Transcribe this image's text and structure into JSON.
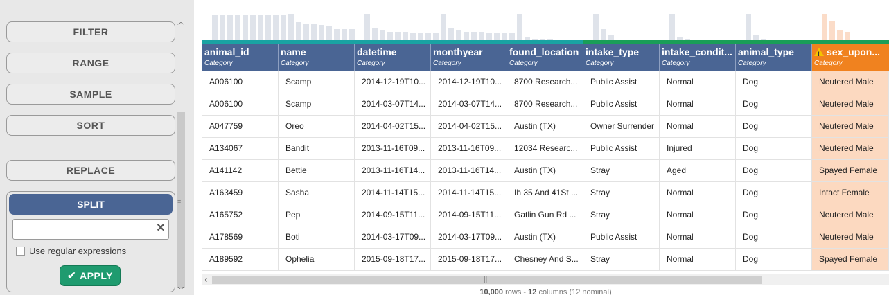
{
  "panel": {
    "buttons": [
      "FILTER",
      "RANGE",
      "SAMPLE",
      "SORT",
      "REPLACE"
    ],
    "split": {
      "title": "SPLIT",
      "input_value": "",
      "regex_label": "Use regular expressions",
      "apply_label": "APPLY"
    }
  },
  "columns": [
    {
      "name": "animal_id",
      "type": "Category",
      "strip": "#1aa3a3",
      "bars": [
        0.9,
        0.9,
        0.9,
        0.9,
        0.9,
        0.9,
        0.9,
        0.9,
        0.9,
        0.9
      ]
    },
    {
      "name": "name",
      "type": "Category",
      "strip": "#1aa3a3",
      "bars": [
        0.95,
        0.65,
        0.6,
        0.6,
        0.55,
        0.5,
        0.4,
        0.4,
        0.4
      ]
    },
    {
      "name": "datetime",
      "type": "Category",
      "strip": "#1aa3a3",
      "bars": [
        0.95,
        0.45,
        0.35,
        0.3,
        0.3,
        0.3,
        0.25,
        0.25,
        0.25,
        0.25
      ]
    },
    {
      "name": "monthyear",
      "type": "Category",
      "strip": "#1aa3a3",
      "bars": [
        0.95,
        0.45,
        0.35,
        0.3,
        0.3,
        0.3,
        0.25,
        0.25,
        0.25,
        0.25
      ]
    },
    {
      "name": "found_location",
      "type": "Category",
      "strip": "#1aa3a3",
      "bars": [
        0.95,
        0.1,
        0.05,
        0.05,
        0.05
      ]
    },
    {
      "name": "intake_type",
      "type": "Category",
      "strip": "#1a9e58",
      "bars": [
        0.95,
        0.4,
        0.2
      ]
    },
    {
      "name": "intake_condit...",
      "type": "Category",
      "strip": "#1a9e58",
      "bars": [
        0.95,
        0.1,
        0.05
      ]
    },
    {
      "name": "animal_type",
      "type": "Category",
      "strip": "#1a9e58",
      "bars": [
        0.95,
        0.2,
        0.05
      ]
    },
    {
      "name": "sex_upon...",
      "type": "Category",
      "strip": "#1a9e58",
      "bars": [
        0.95,
        0.7,
        0.35,
        0.3
      ],
      "warn": true
    }
  ],
  "rows": [
    [
      "A006100",
      "Scamp",
      "2014-12-19T10...",
      "2014-12-19T10...",
      "8700 Research...",
      "Public Assist",
      "Normal",
      "Dog",
      "Neutered Male"
    ],
    [
      "A006100",
      "Scamp",
      "2014-03-07T14...",
      "2014-03-07T14...",
      "8700 Research...",
      "Public Assist",
      "Normal",
      "Dog",
      "Neutered Male"
    ],
    [
      "A047759",
      "Oreo",
      "2014-04-02T15...",
      "2014-04-02T15...",
      "Austin (TX)",
      "Owner Surrender",
      "Normal",
      "Dog",
      "Neutered Male"
    ],
    [
      "A134067",
      "Bandit",
      "2013-11-16T09...",
      "2013-11-16T09...",
      "12034 Researc...",
      "Public Assist",
      "Injured",
      "Dog",
      "Neutered Male"
    ],
    [
      "A141142",
      "Bettie",
      "2013-11-16T14...",
      "2013-11-16T14...",
      "Austin (TX)",
      "Stray",
      "Aged",
      "Dog",
      "Spayed Female"
    ],
    [
      "A163459",
      "Sasha",
      "2014-11-14T15...",
      "2014-11-14T15...",
      "Ih 35 And 41St ...",
      "Stray",
      "Normal",
      "Dog",
      "Intact Female"
    ],
    [
      "A165752",
      "Pep",
      "2014-09-15T11...",
      "2014-09-15T11...",
      "Gatlin Gun Rd ...",
      "Stray",
      "Normal",
      "Dog",
      "Neutered Male"
    ],
    [
      "A178569",
      "Boti",
      "2014-03-17T09...",
      "2014-03-17T09...",
      "Austin (TX)",
      "Public Assist",
      "Normal",
      "Dog",
      "Neutered Male"
    ],
    [
      "A189592",
      "Ophelia",
      "2015-09-18T17...",
      "2015-09-18T17...",
      "Chesney And S...",
      "Stray",
      "Normal",
      "Dog",
      "Spayed Female"
    ]
  ],
  "footer": {
    "rows_count": "10,000",
    "rows_word": "rows",
    "sep": "-",
    "cols_count": "12",
    "cols_word": "columns",
    "nominal": "(12 nominal)"
  }
}
